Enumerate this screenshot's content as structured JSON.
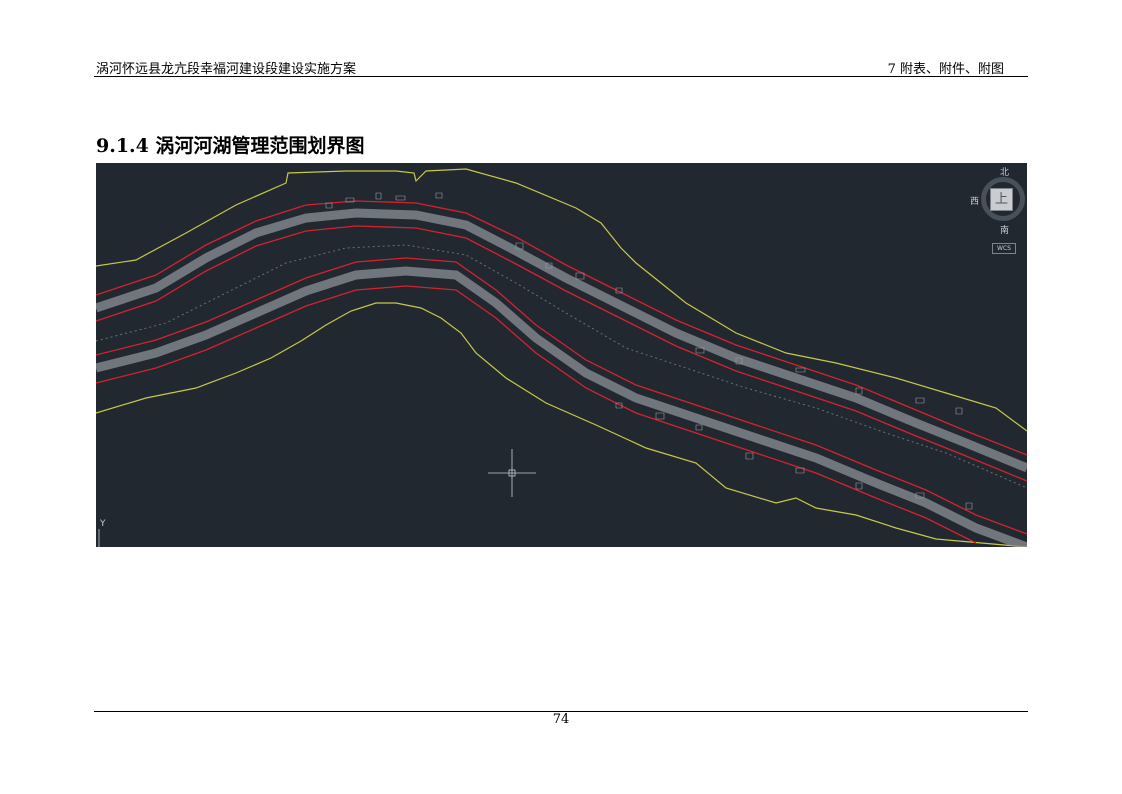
{
  "header": {
    "left_title": "涡河怀远县龙亢段幸福河建设段建设实施方案",
    "right_title": "7 附表、附件、附图"
  },
  "section": {
    "title": "9.1.4 涡河河湖管理范围划界图"
  },
  "cad_view": {
    "viewcube": {
      "north": "北",
      "south": "南",
      "west": "西",
      "face": "上",
      "wcs": "WCS"
    },
    "ucs_axis": "Y",
    "colors": {
      "background": "#212830",
      "boundary": "#c8c84a",
      "river_line": "#d4232e",
      "road": "#8c9096"
    }
  },
  "footer": {
    "page_number": "74"
  }
}
